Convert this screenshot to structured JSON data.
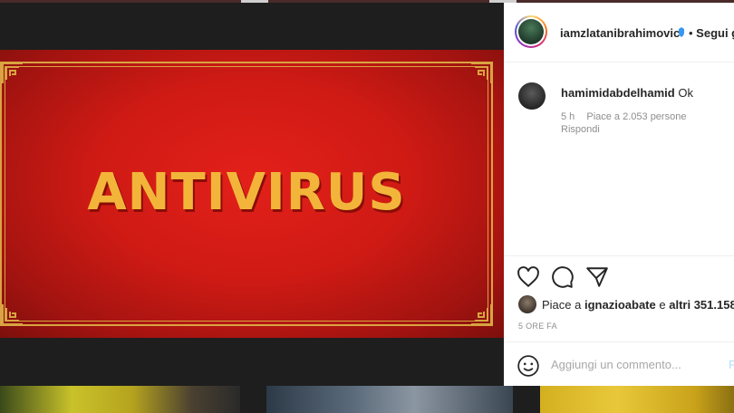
{
  "post": {
    "headline": "ANTIVIRUS"
  },
  "header": {
    "username": "iamzlatanibrahimovic",
    "follow_label": "Segui g"
  },
  "comment": {
    "username": "hamimidabdelhamid",
    "text": "Ok",
    "time": "5 h",
    "likes": "Piace a 2.053 persone",
    "reply_label": "Rispondi"
  },
  "actions": {
    "liked_by_prefix": "Piace a",
    "liked_by_user": "ignazioabate",
    "liked_by_suffix_prefix": "e",
    "liked_by_others": "altri 351.158",
    "timestamp": "5 ORE FA"
  },
  "add_comment": {
    "placeholder": "Aggiungi un commento...",
    "publish_label": "P"
  },
  "colors": {
    "media_red": "#cf1a14",
    "frame_gold": "#d9a441",
    "headline_gold": "#f2b53a",
    "verified_blue": "#3897f0"
  },
  "icons": [
    "heart-icon",
    "comment-icon",
    "share-icon",
    "emoji-icon",
    "verified-icon"
  ]
}
